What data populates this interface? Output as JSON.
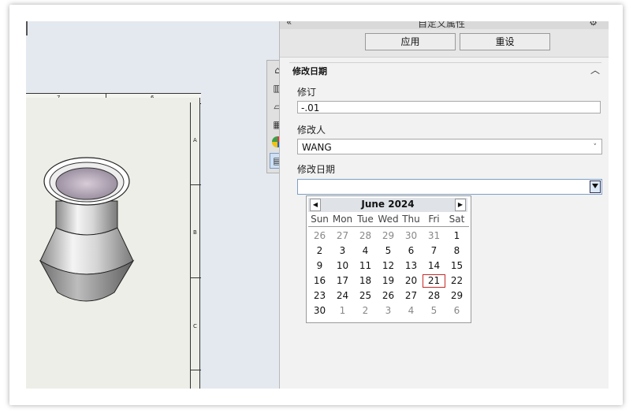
{
  "pane": {
    "title": "自定义属性",
    "collapse_glyph": "«",
    "apply_label": "应用",
    "reset_label": "重设",
    "section_title": "修改日期",
    "fields": [
      {
        "label": "修订",
        "value": "-.01"
      },
      {
        "label": "修改人",
        "value": "WANG"
      },
      {
        "label": "修改日期",
        "value": ""
      }
    ]
  },
  "drawing": {
    "column_labels": [
      "7",
      "6"
    ],
    "row_labels": [
      "A",
      "B",
      "C"
    ]
  },
  "calendar": {
    "month_label": "June 2024",
    "prev_glyph": "◀",
    "next_glyph": "▶",
    "weekdays": [
      "Sun",
      "Mon",
      "Tue",
      "Wed",
      "Thu",
      "Fri",
      "Sat"
    ],
    "weeks": [
      [
        {
          "d": "26",
          "o": true
        },
        {
          "d": "27",
          "o": true
        },
        {
          "d": "28",
          "o": true
        },
        {
          "d": "29",
          "o": true
        },
        {
          "d": "30",
          "o": true
        },
        {
          "d": "31",
          "o": true
        },
        {
          "d": "1"
        }
      ],
      [
        {
          "d": "2"
        },
        {
          "d": "3"
        },
        {
          "d": "4"
        },
        {
          "d": "5"
        },
        {
          "d": "6"
        },
        {
          "d": "7"
        },
        {
          "d": "8"
        }
      ],
      [
        {
          "d": "9"
        },
        {
          "d": "10"
        },
        {
          "d": "11"
        },
        {
          "d": "12"
        },
        {
          "d": "13"
        },
        {
          "d": "14"
        },
        {
          "d": "15"
        }
      ],
      [
        {
          "d": "16"
        },
        {
          "d": "17"
        },
        {
          "d": "18"
        },
        {
          "d": "19"
        },
        {
          "d": "20"
        },
        {
          "d": "21",
          "today": true
        },
        {
          "d": "22"
        }
      ],
      [
        {
          "d": "23"
        },
        {
          "d": "24"
        },
        {
          "d": "25"
        },
        {
          "d": "26"
        },
        {
          "d": "27"
        },
        {
          "d": "28"
        },
        {
          "d": "29"
        }
      ],
      [
        {
          "d": "30"
        },
        {
          "d": "1",
          "o": true
        },
        {
          "d": "2",
          "o": true
        },
        {
          "d": "3",
          "o": true
        },
        {
          "d": "4",
          "o": true
        },
        {
          "d": "5",
          "o": true
        },
        {
          "d": "6",
          "o": true
        }
      ]
    ]
  },
  "icons": [
    "home-icon",
    "parts-icon",
    "folder-icon",
    "view-palette-icon",
    "appearance-icon",
    "custom-properties-icon"
  ],
  "colors": {
    "today_outline": "#c62828",
    "pane_bg": "#f2f2f2",
    "sheet_bg": "#eeeee8"
  }
}
